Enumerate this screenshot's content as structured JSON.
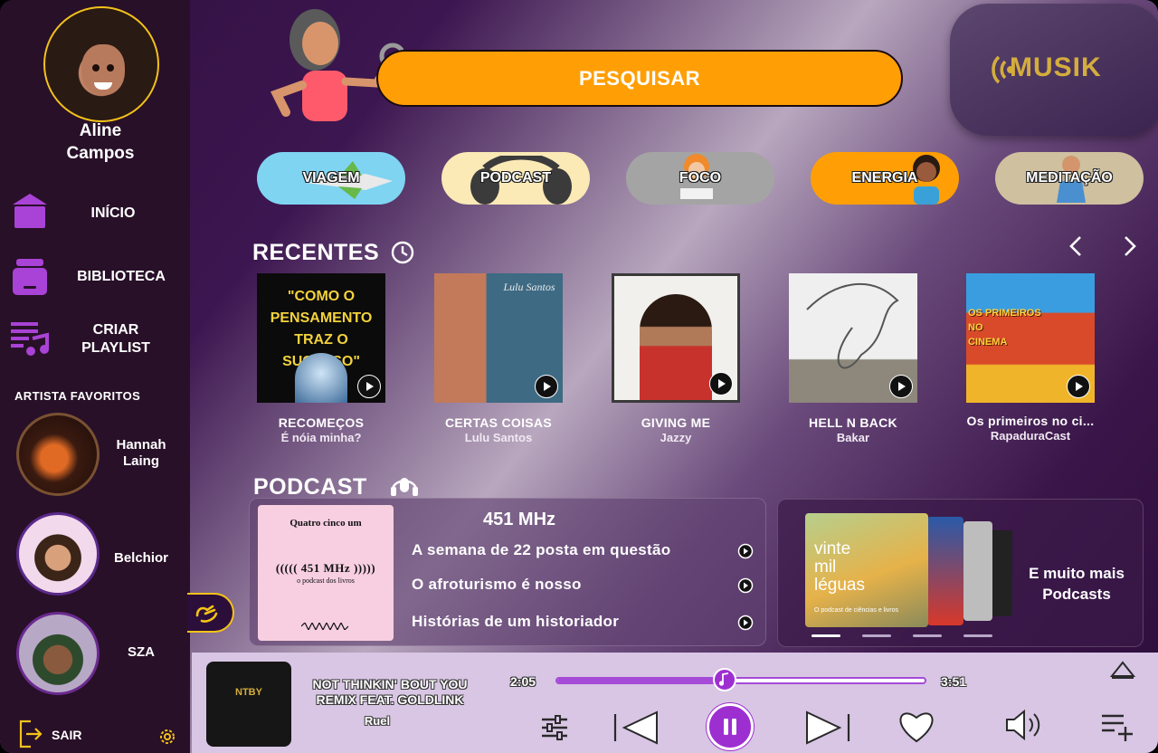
{
  "user": {
    "name": "Aline\nCampos"
  },
  "nav": {
    "home": "INÍCIO",
    "library": "BIBLIOTECA",
    "create_playlist": "CRIAR\nPLAYLIST"
  },
  "favorites": {
    "title": "ARTISTA FAVORITOS",
    "artists": [
      {
        "name": "Hannah\nLaing"
      },
      {
        "name": "Belchior"
      },
      {
        "name": "SZA"
      }
    ]
  },
  "logout": "SAIR",
  "search": {
    "label": "PESQUISAR"
  },
  "logo": {
    "text": "MUSIK"
  },
  "categories": [
    {
      "label": "VIAGEM",
      "color": "#7fd4f2"
    },
    {
      "label": "PODCAST",
      "color": "#fbe9b6"
    },
    {
      "label": "FOCO",
      "color": "#a4a4a4"
    },
    {
      "label": "ENERGIA",
      "color": "#ff9f05"
    },
    {
      "label": "MEDITAÇÃO",
      "color": "#cfc0a0"
    }
  ],
  "recent": {
    "title": "RECENTES",
    "items": [
      {
        "title": "RECOMEÇOS",
        "subtitle": "É nóia minha?",
        "cover_text": "\"COMO O\nPENSAMENTO\nTRAZ O SUCESSO\""
      },
      {
        "title": "CERTAS COISAS",
        "subtitle": "Lulu Santos",
        "cover_text": "Lulu Santos"
      },
      {
        "title": "GIVING ME",
        "subtitle": "Jazzy",
        "cover_text": ""
      },
      {
        "title": "HELL N BACK",
        "subtitle": "Bakar",
        "cover_text": ""
      },
      {
        "title": "Os primeiros no ci...",
        "subtitle": "RapaduraCast",
        "cover_text": "OS PRIMEIROS NO\nCINEMA"
      }
    ]
  },
  "podcast": {
    "title": "PODCAST",
    "featured": {
      "name": "451 MHz",
      "cover_top": "Quatro cinco um",
      "cover_main": "((((( 451 MHz )))))",
      "cover_sub": "o podcast dos livros",
      "episodes": [
        "A semana de 22 posta em questão",
        "O afroturismo é nosso",
        "Histórias de um historiador"
      ]
    },
    "more": {
      "label": "E muito mais\nPodcasts",
      "cover_title": "vinte\nmil\nléguas",
      "cover_sub": "O podcast de ciências e livros",
      "carousel_pages": 4,
      "active_page": 1
    }
  },
  "player": {
    "title": "NOT THINKIN' BOUT YOU\nREMIX FEAT. GOLDLINK",
    "artist": "Ruel",
    "elapsed": "2:05",
    "duration": "3:51",
    "progress": 0.46,
    "cover_text": "NTBY"
  },
  "colors": {
    "accent": "#ff9f05",
    "purple": "#a64ad8",
    "gold": "#f3c21a"
  }
}
